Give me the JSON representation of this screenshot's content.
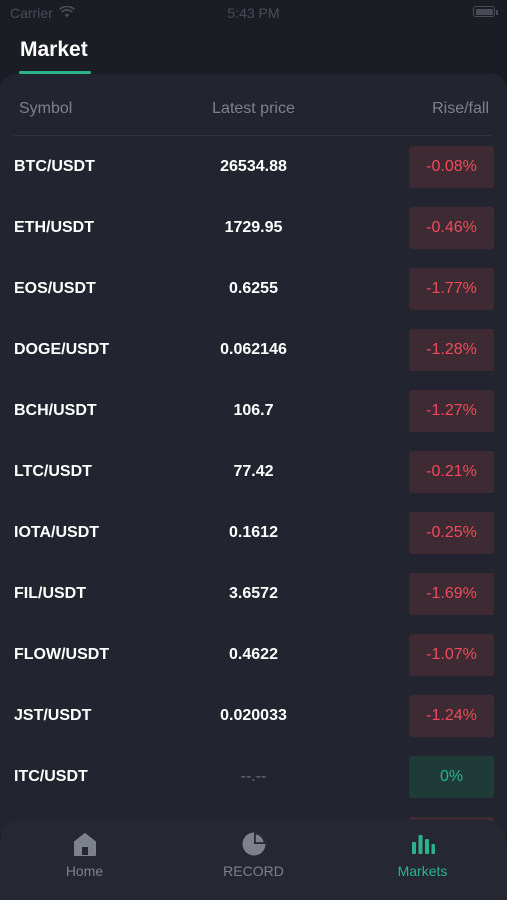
{
  "status_bar": {
    "carrier": "Carrier",
    "time": "5:43 PM"
  },
  "header": {
    "title": "Market"
  },
  "columns": {
    "symbol": "Symbol",
    "price": "Latest price",
    "rise_fall": "Rise/fall"
  },
  "rows": [
    {
      "symbol": "BTC/USDT",
      "price": "26534.88",
      "change": "-0.08%",
      "trend": "down"
    },
    {
      "symbol": "ETH/USDT",
      "price": "1729.95",
      "change": "-0.46%",
      "trend": "down"
    },
    {
      "symbol": "EOS/USDT",
      "price": "0.6255",
      "change": "-1.77%",
      "trend": "down"
    },
    {
      "symbol": "DOGE/USDT",
      "price": "0.062146",
      "change": "-1.28%",
      "trend": "down"
    },
    {
      "symbol": "BCH/USDT",
      "price": "106.7",
      "change": "-1.27%",
      "trend": "down"
    },
    {
      "symbol": "LTC/USDT",
      "price": "77.42",
      "change": "-0.21%",
      "trend": "down"
    },
    {
      "symbol": "IOTA/USDT",
      "price": "0.1612",
      "change": "-0.25%",
      "trend": "down"
    },
    {
      "symbol": "FIL/USDT",
      "price": "3.6572",
      "change": "-1.69%",
      "trend": "down"
    },
    {
      "symbol": "FLOW/USDT",
      "price": "0.4622",
      "change": "-1.07%",
      "trend": "down"
    },
    {
      "symbol": "JST/USDT",
      "price": "0.020033",
      "change": "-1.24%",
      "trend": "down"
    },
    {
      "symbol": "ITC/USDT",
      "price": "--.--",
      "change": "0%",
      "trend": "flat"
    }
  ],
  "tabs": [
    {
      "label": "Home",
      "icon": "home-icon",
      "active": false
    },
    {
      "label": "RECORD",
      "icon": "pie-chart-icon",
      "active": false
    },
    {
      "label": "Markets",
      "icon": "bar-chart-icon",
      "active": true
    }
  ],
  "colors": {
    "background": "#1b1d25",
    "panel": "#22252f",
    "accent": "#2bb38a",
    "down_text": "#f04a5c",
    "down_bg": "#3e2a32",
    "flat_bg": "#1f3b37"
  }
}
